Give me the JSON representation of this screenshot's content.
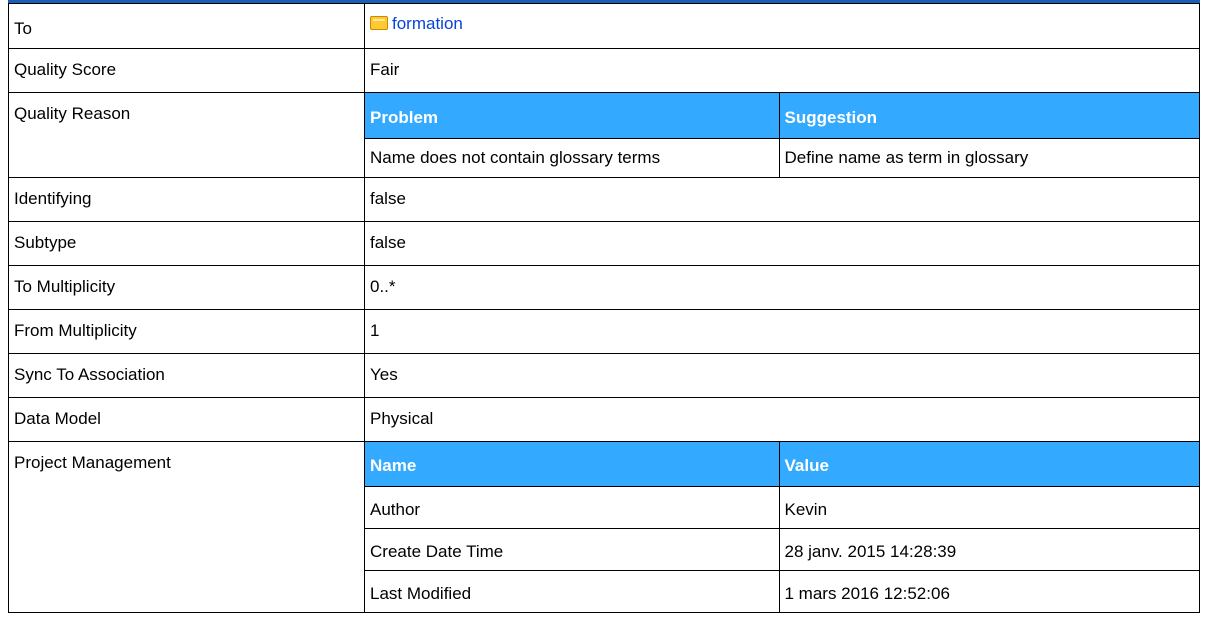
{
  "properties": {
    "to": {
      "label": "To",
      "value": "formation",
      "icon": "folder-icon"
    },
    "quality_score": {
      "label": "Quality Score",
      "value": "Fair"
    },
    "quality_reason": {
      "label": "Quality Reason",
      "headers": [
        "Problem",
        "Suggestion"
      ],
      "rows": [
        [
          "Name does not contain glossary terms",
          "Define name as term in glossary"
        ]
      ]
    },
    "identifying": {
      "label": "Identifying",
      "value": "false"
    },
    "subtype": {
      "label": "Subtype",
      "value": "false"
    },
    "to_multiplicity": {
      "label": "To Multiplicity",
      "value": "0..*"
    },
    "from_multiplicity": {
      "label": "From Multiplicity",
      "value": "1"
    },
    "sync_to_association": {
      "label": "Sync To Association",
      "value": "Yes"
    },
    "data_model": {
      "label": "Data Model",
      "value": "Physical"
    },
    "project_management": {
      "label": "Project Management",
      "headers": [
        "Name",
        "Value"
      ],
      "rows": [
        [
          "Author",
          "Kevin"
        ],
        [
          "Create Date Time",
          "28 janv. 2015 14:28:39"
        ],
        [
          "Last Modified",
          "1 mars 2016 12:52:06"
        ]
      ]
    }
  },
  "colors": {
    "header_bar": "#1a5fb4",
    "table_header_bg": "#33aaff",
    "table_header_text": "#ffffff",
    "link": "#0645d8",
    "border": "#000000"
  }
}
